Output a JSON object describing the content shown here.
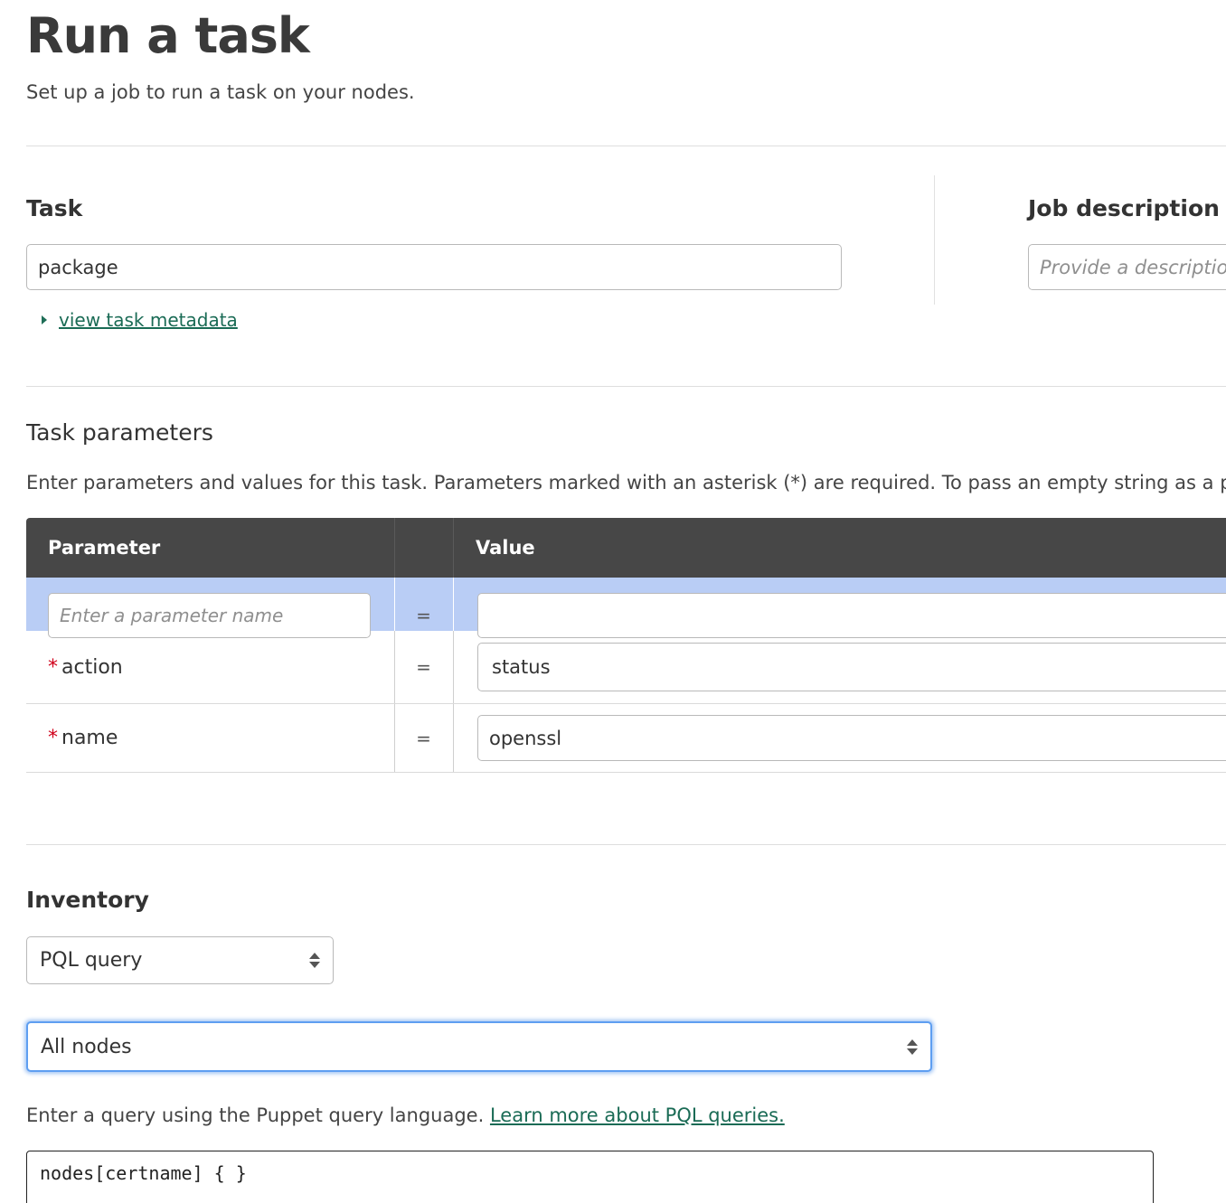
{
  "page": {
    "title": "Run a task",
    "subtitle": "Set up a job to run a task on your nodes."
  },
  "task": {
    "heading": "Task",
    "value": "package",
    "metadata_link": "view task metadata"
  },
  "job_description": {
    "heading": "Job description",
    "placeholder": "Provide a description"
  },
  "task_parameters": {
    "heading": "Task parameters",
    "description": "Enter parameters and values for this task. Parameters marked with an asterisk (*) are required. To pass an empty string as a para",
    "columns": [
      "Parameter",
      "Value"
    ],
    "equals_sign": "=",
    "new_row": {
      "name_placeholder": "Enter a parameter name",
      "value": ""
    },
    "rows": [
      {
        "required_mark": "*",
        "name": "action",
        "value": "status"
      },
      {
        "required_mark": "*",
        "name": "name",
        "value": "openssl"
      }
    ]
  },
  "inventory": {
    "heading": "Inventory",
    "type_select": "PQL query",
    "query_select": "All nodes",
    "help_text": "Enter a query using the Puppet query language.",
    "help_link": "Learn more about PQL queries.",
    "query_code": "nodes[certname] { }"
  },
  "colors": {
    "table_header": "#474747",
    "editing_row": "#b9cdf5",
    "link": "#1a6b55",
    "required": "#d0021b",
    "focus": "#5e9ef1"
  }
}
